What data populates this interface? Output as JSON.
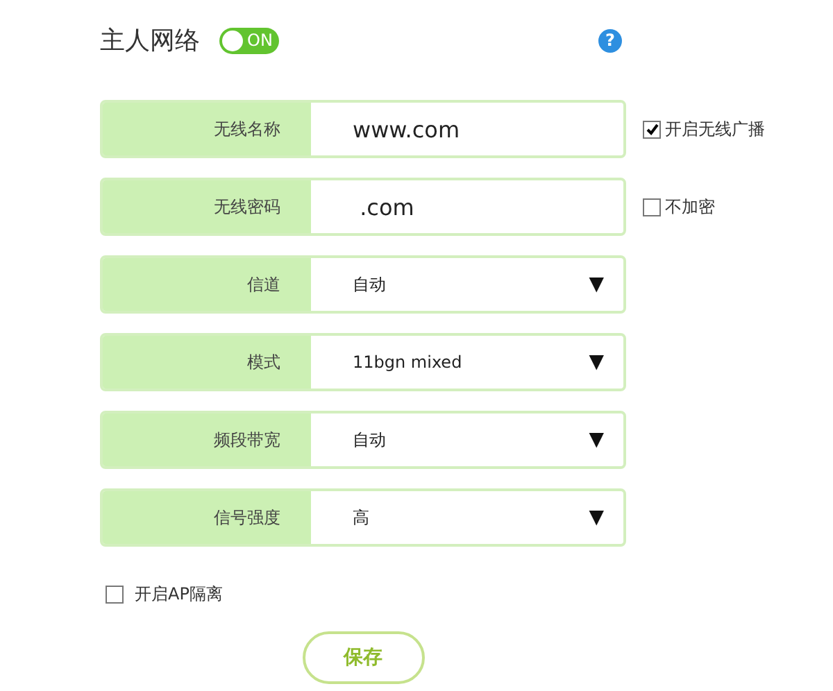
{
  "header": {
    "title": "主人网络",
    "toggle": {
      "on": true,
      "label": "ON"
    },
    "help": "?"
  },
  "rows": [
    {
      "kind": "text",
      "label": "无线名称",
      "value": "www.com",
      "option": {
        "label": "开启无线广播",
        "checked": true
      }
    },
    {
      "kind": "text",
      "label": "无线密码",
      "value": " .com",
      "option": {
        "label": "不加密",
        "checked": false
      }
    },
    {
      "kind": "select",
      "label": "信道",
      "value": "自动",
      "caret": "▼"
    },
    {
      "kind": "select",
      "label": "模式",
      "value": "11bgn mixed",
      "caret": "▼"
    },
    {
      "kind": "select",
      "label": "频段带宽",
      "value": "自动",
      "caret": "▼"
    },
    {
      "kind": "select",
      "label": "信号强度",
      "value": "高",
      "caret": "▼"
    }
  ],
  "ap_isolation": {
    "label": "开启AP隔离",
    "checked": false
  },
  "save": "保存"
}
